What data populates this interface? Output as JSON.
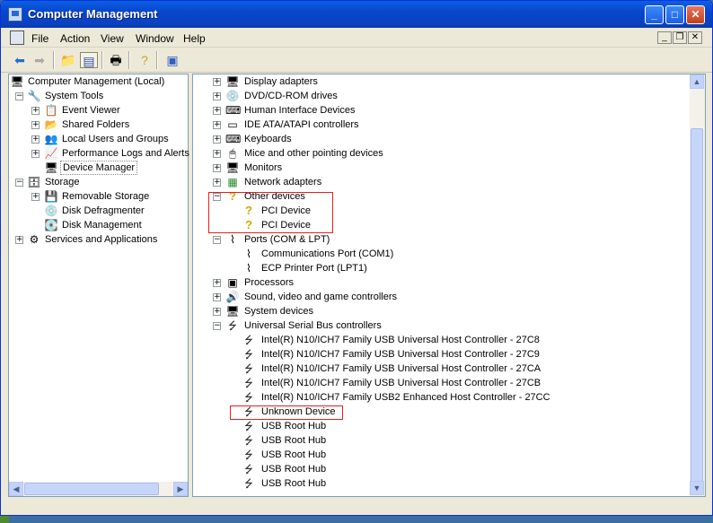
{
  "window": {
    "title": "Computer Management"
  },
  "menu": {
    "items": [
      "File",
      "Action",
      "View",
      "Window",
      "Help"
    ]
  },
  "left_tree": {
    "root": "Computer Management (Local)",
    "system_tools": "System Tools",
    "event_viewer": "Event Viewer",
    "shared_folders": "Shared Folders",
    "local_users": "Local Users and Groups",
    "perf_logs": "Performance Logs and Alerts",
    "device_manager": "Device Manager",
    "storage": "Storage",
    "removable": "Removable Storage",
    "defrag": "Disk Defragmenter",
    "disk_mgmt": "Disk Management",
    "services": "Services and Applications"
  },
  "devices": {
    "display": "Display adapters",
    "dvd": "DVD/CD-ROM drives",
    "hid": "Human Interface Devices",
    "ide": "IDE ATA/ATAPI controllers",
    "keyboards": "Keyboards",
    "mice": "Mice and other pointing devices",
    "monitors": "Monitors",
    "network": "Network adapters",
    "other": "Other devices",
    "pci1": "PCI Device",
    "pci2": "PCI Device",
    "ports": "Ports (COM & LPT)",
    "com1": "Communications Port (COM1)",
    "lpt1": "ECP Printer Port (LPT1)",
    "processors": "Processors",
    "sound": "Sound, video and game controllers",
    "system": "System devices",
    "usb": "Universal Serial Bus controllers",
    "usb1": "Intel(R) N10/ICH7 Family USB Universal Host Controller - 27C8",
    "usb2": "Intel(R) N10/ICH7 Family USB Universal Host Controller - 27C9",
    "usb3": "Intel(R) N10/ICH7 Family USB Universal Host Controller - 27CA",
    "usb4": "Intel(R) N10/ICH7 Family USB Universal Host Controller - 27CB",
    "usb5": "Intel(R) N10/ICH7 Family USB2 Enhanced Host Controller - 27CC",
    "unknown": "Unknown Device",
    "hub1": "USB Root Hub",
    "hub2": "USB Root Hub",
    "hub3": "USB Root Hub",
    "hub4": "USB Root Hub",
    "hub5": "USB Root Hub"
  },
  "colors": {
    "highlight_box": "#e02020",
    "titlebar": "#0846cb"
  }
}
